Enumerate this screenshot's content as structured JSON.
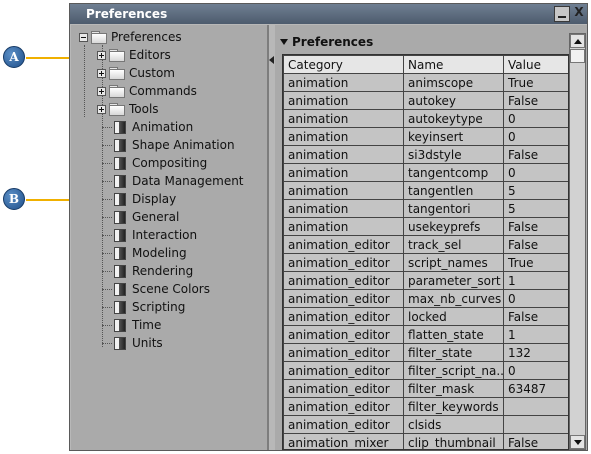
{
  "window": {
    "title": "Preferences",
    "close_label": "X"
  },
  "callouts": {
    "a": "A",
    "b": "B"
  },
  "tree": {
    "root": "Preferences",
    "folders": [
      "Editors",
      "Custom",
      "Commands",
      "Tools"
    ],
    "items": [
      "Animation",
      "Shape Animation",
      "Compositing",
      "Data Management",
      "Display",
      "General",
      "Interaction",
      "Modeling",
      "Rendering",
      "Scene Colors",
      "Scripting",
      "Time",
      "Units"
    ]
  },
  "panel": {
    "header": "Preferences"
  },
  "table": {
    "columns": [
      "Category",
      "Name",
      "Value"
    ],
    "rows": [
      [
        "animation",
        "animscope",
        "True"
      ],
      [
        "animation",
        "autokey",
        "False"
      ],
      [
        "animation",
        "autokeytype",
        "0"
      ],
      [
        "animation",
        "keyinsert",
        "0"
      ],
      [
        "animation",
        "si3dstyle",
        "False"
      ],
      [
        "animation",
        "tangentcomp",
        "0"
      ],
      [
        "animation",
        "tangentlen",
        "5"
      ],
      [
        "animation",
        "tangentori",
        "5"
      ],
      [
        "animation",
        "usekeyprefs",
        "False"
      ],
      [
        "animation_editor",
        "track_sel",
        "False"
      ],
      [
        "animation_editor",
        "script_names",
        "True"
      ],
      [
        "animation_editor",
        "parameter_sort",
        "1"
      ],
      [
        "animation_editor",
        "max_nb_curves",
        "0"
      ],
      [
        "animation_editor",
        "locked",
        "False"
      ],
      [
        "animation_editor",
        "flatten_state",
        "1"
      ],
      [
        "animation_editor",
        "filter_state",
        "132"
      ],
      [
        "animation_editor",
        "filter_script_na...",
        "0"
      ],
      [
        "animation_editor",
        "filter_mask",
        "63487"
      ],
      [
        "animation_editor",
        "filter_keywords",
        ""
      ],
      [
        "animation_editor",
        "clsids",
        ""
      ],
      [
        "animation_mixer",
        "clip_thumbnail",
        "False"
      ]
    ]
  },
  "colors": {
    "titlebar": "#5a687a",
    "panel_bg": "#aaaaaa",
    "callout_fill": "#2f62a0",
    "callout_line": "#f0b000"
  }
}
